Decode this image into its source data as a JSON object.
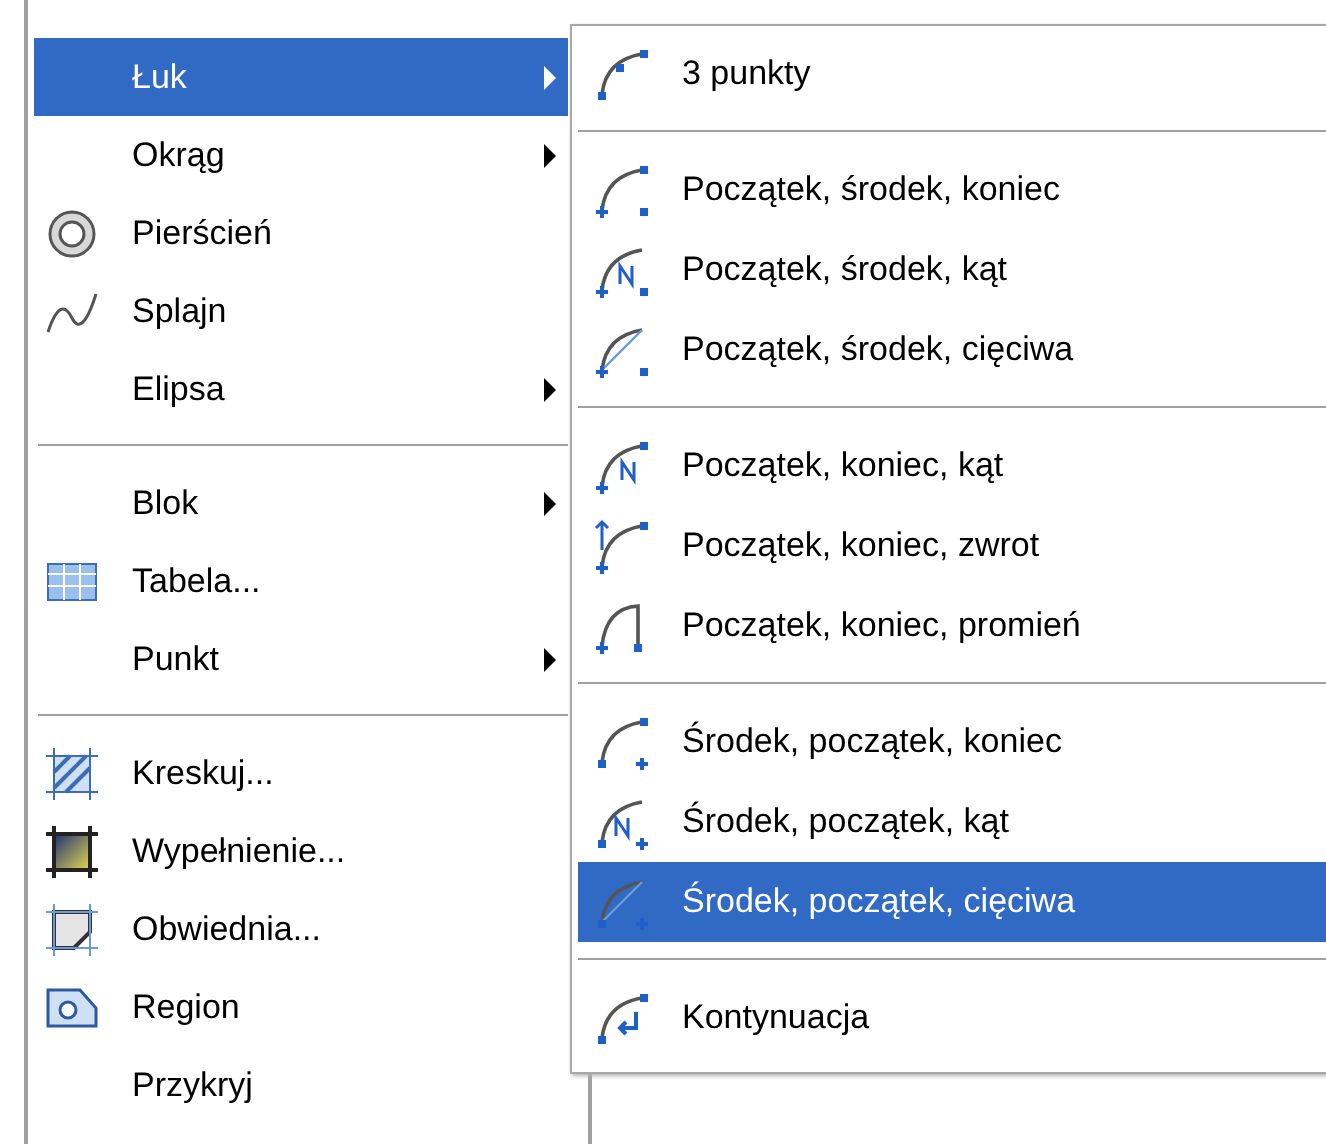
{
  "menu": {
    "groups": [
      [
        {
          "label": "Łuk",
          "submenu": true,
          "selected": true
        },
        {
          "label": "Okrąg",
          "submenu": true,
          "selected": false
        },
        {
          "label": "Pierścień",
          "submenu": false,
          "selected": false
        },
        {
          "label": "Splajn",
          "submenu": false,
          "selected": false
        },
        {
          "label": "Elipsa",
          "submenu": true,
          "selected": false
        }
      ],
      [
        {
          "label": "Blok",
          "submenu": true,
          "selected": false
        },
        {
          "label": "Tabela...",
          "submenu": false,
          "selected": false
        },
        {
          "label": "Punkt",
          "submenu": true,
          "selected": false
        }
      ],
      [
        {
          "label": "Kreskuj...",
          "submenu": false,
          "selected": false
        },
        {
          "label": "Wypełnienie...",
          "submenu": false,
          "selected": false
        },
        {
          "label": "Obwiednia...",
          "submenu": false,
          "selected": false
        },
        {
          "label": "Region",
          "submenu": false,
          "selected": false
        },
        {
          "label": "Przykryj",
          "submenu": false,
          "selected": false
        }
      ]
    ]
  },
  "submenu": {
    "groups": [
      [
        {
          "label": "3 punkty",
          "selected": false
        }
      ],
      [
        {
          "label": "Początek, środek, koniec",
          "selected": false
        },
        {
          "label": "Początek, środek, kąt",
          "selected": false
        },
        {
          "label": "Początek, środek, cięciwa",
          "selected": false
        }
      ],
      [
        {
          "label": "Początek, koniec, kąt",
          "selected": false
        },
        {
          "label": "Początek, koniec, zwrot",
          "selected": false
        },
        {
          "label": "Początek, koniec, promień",
          "selected": false
        }
      ],
      [
        {
          "label": "Środek, początek, koniec",
          "selected": false
        },
        {
          "label": "Środek, początek, kąt",
          "selected": false
        },
        {
          "label": "Środek, początek, cięciwa",
          "selected": true
        }
      ],
      [
        {
          "label": "Kontynuacja",
          "selected": false
        }
      ]
    ]
  }
}
